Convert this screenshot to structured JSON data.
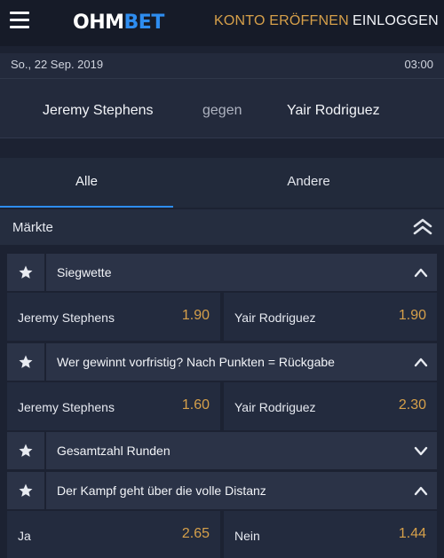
{
  "header": {
    "logo_part1": "OHM",
    "logo_part2": "BET",
    "register_label": "KONTO ERÖFFNEN",
    "login_label": "EINLOGGEN"
  },
  "event": {
    "date": "So., 22 Sep. 2019",
    "time": "03:00",
    "team1": "Jeremy Stephens",
    "versus": "gegen",
    "team2": "Yair Rodriguez"
  },
  "tabs": [
    {
      "label": "Alle",
      "active": true
    },
    {
      "label": "Andere",
      "active": false
    }
  ],
  "markets_section": {
    "title": "Märkte"
  },
  "markets": [
    {
      "title": "Siegwette",
      "expanded": true,
      "outcomes": [
        {
          "name": "Jeremy Stephens",
          "odds": "1.90"
        },
        {
          "name": "Yair Rodriguez",
          "odds": "1.90"
        }
      ]
    },
    {
      "title": "Wer gewinnt vorfristig? Nach Punkten = Rückgabe",
      "expanded": true,
      "outcomes": [
        {
          "name": "Jeremy Stephens",
          "odds": "1.60"
        },
        {
          "name": "Yair Rodriguez",
          "odds": "2.30"
        }
      ]
    },
    {
      "title": "Gesamtzahl Runden",
      "expanded": false,
      "outcomes": []
    },
    {
      "title": "Der Kampf geht über die volle Distanz",
      "expanded": true,
      "outcomes": [
        {
          "name": "Ja",
          "odds": "2.65"
        },
        {
          "name": "Nein",
          "odds": "1.44"
        }
      ]
    }
  ],
  "colors": {
    "background": "#1c2232",
    "accent_blue": "#2e8df0",
    "odds_gold": "#d6a04a"
  },
  "icons": [
    "hamburger-menu-icon",
    "double-chevron-up-icon",
    "star-icon",
    "chevron-up-icon",
    "chevron-down-icon"
  ]
}
